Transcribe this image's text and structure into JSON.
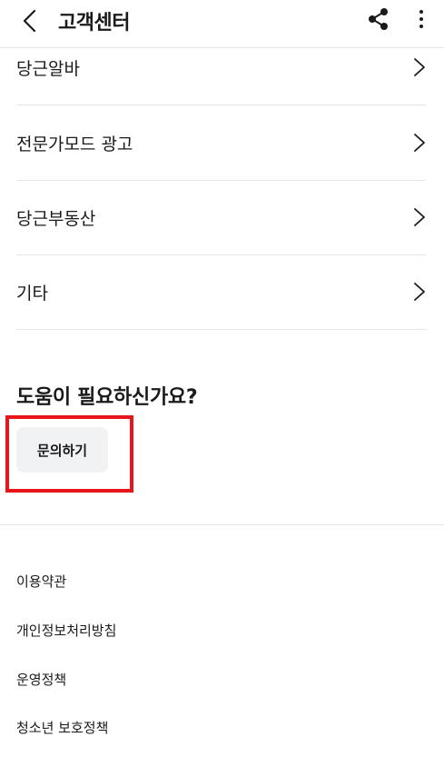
{
  "header": {
    "title": "고객센터",
    "back_icon": "chevron-left-icon",
    "share_icon": "share-icon",
    "more_icon": "more-vertical-icon"
  },
  "menu_items": [
    {
      "label": "당근알바"
    },
    {
      "label": "전문가모드 광고"
    },
    {
      "label": "당근부동산"
    },
    {
      "label": "기타"
    }
  ],
  "help": {
    "title": "도움이 필요하신가요?",
    "button_label": "문의하기",
    "highlight_color": "#e8161b"
  },
  "footer_links": [
    {
      "label": "이용약관"
    },
    {
      "label": "개인정보처리방침"
    },
    {
      "label": "운영정책"
    },
    {
      "label": "청소년 보호정책"
    }
  ]
}
